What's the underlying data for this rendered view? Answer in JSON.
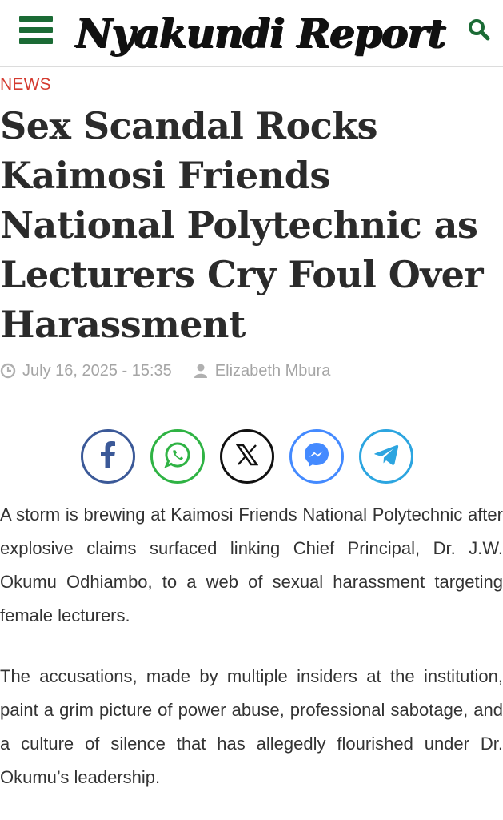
{
  "header": {
    "logo_text": "Nyakundi Report",
    "menu_icon": "hamburger-menu-icon",
    "search_icon": "search-icon",
    "accent_color": "#1b6b35"
  },
  "article": {
    "category": "NEWS",
    "category_color": "#d43a2f",
    "title": "Sex Scandal Rocks Kaimosi Friends National Polytechnic as Lecturers Cry Foul Over Harassment",
    "date": "July 16, 2025 - 15:35",
    "author": "Elizabeth Mbura",
    "paragraphs": [
      "A storm is brewing at Kaimosi Friends National Polytechnic after explosive claims surfaced linking Chief Principal, Dr. J.W. Okumu Odhiambo, to a web of sexual harassment targeting female lecturers.",
      "The accusations, made by multiple insiders at the institution, paint a grim picture of power abuse, professional sabotage, and a culture of silence that has allegedly flourished under Dr. Okumu’s leadership."
    ]
  },
  "share": [
    {
      "name": "facebook",
      "icon": "facebook-icon",
      "color": "#3b5998"
    },
    {
      "name": "whatsapp",
      "icon": "whatsapp-icon",
      "color": "#2fb344"
    },
    {
      "name": "x",
      "icon": "x-icon",
      "color": "#111111"
    },
    {
      "name": "messenger",
      "icon": "messenger-icon",
      "color": "#448aff"
    },
    {
      "name": "telegram",
      "icon": "telegram-icon",
      "color": "#2ca5e0"
    }
  ]
}
